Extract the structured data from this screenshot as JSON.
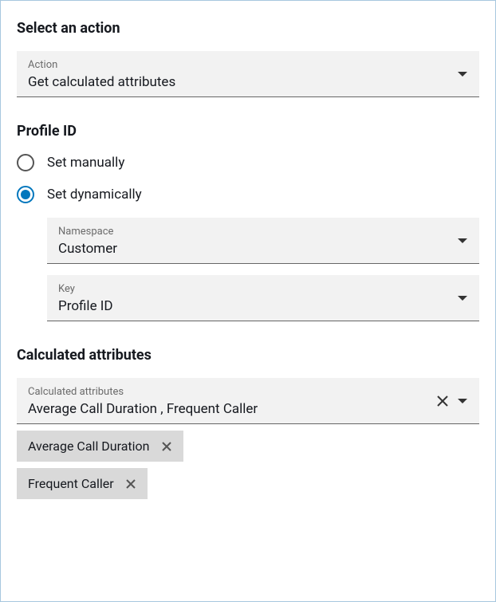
{
  "selectActionTitle": "Select an action",
  "action": {
    "label": "Action",
    "value": "Get calculated attributes"
  },
  "profileId": {
    "title": "Profile ID",
    "radios": {
      "manual": "Set manually",
      "dynamic": "Set dynamically"
    },
    "namespace": {
      "label": "Namespace",
      "value": "Customer"
    },
    "key": {
      "label": "Key",
      "value": "Profile ID"
    }
  },
  "calcAttrs": {
    "title": "Calculated attributes",
    "label": "Calculated attributes",
    "value": "Average Call Duration , Frequent Caller",
    "chips": [
      "Average Call Duration",
      "Frequent Caller"
    ]
  }
}
